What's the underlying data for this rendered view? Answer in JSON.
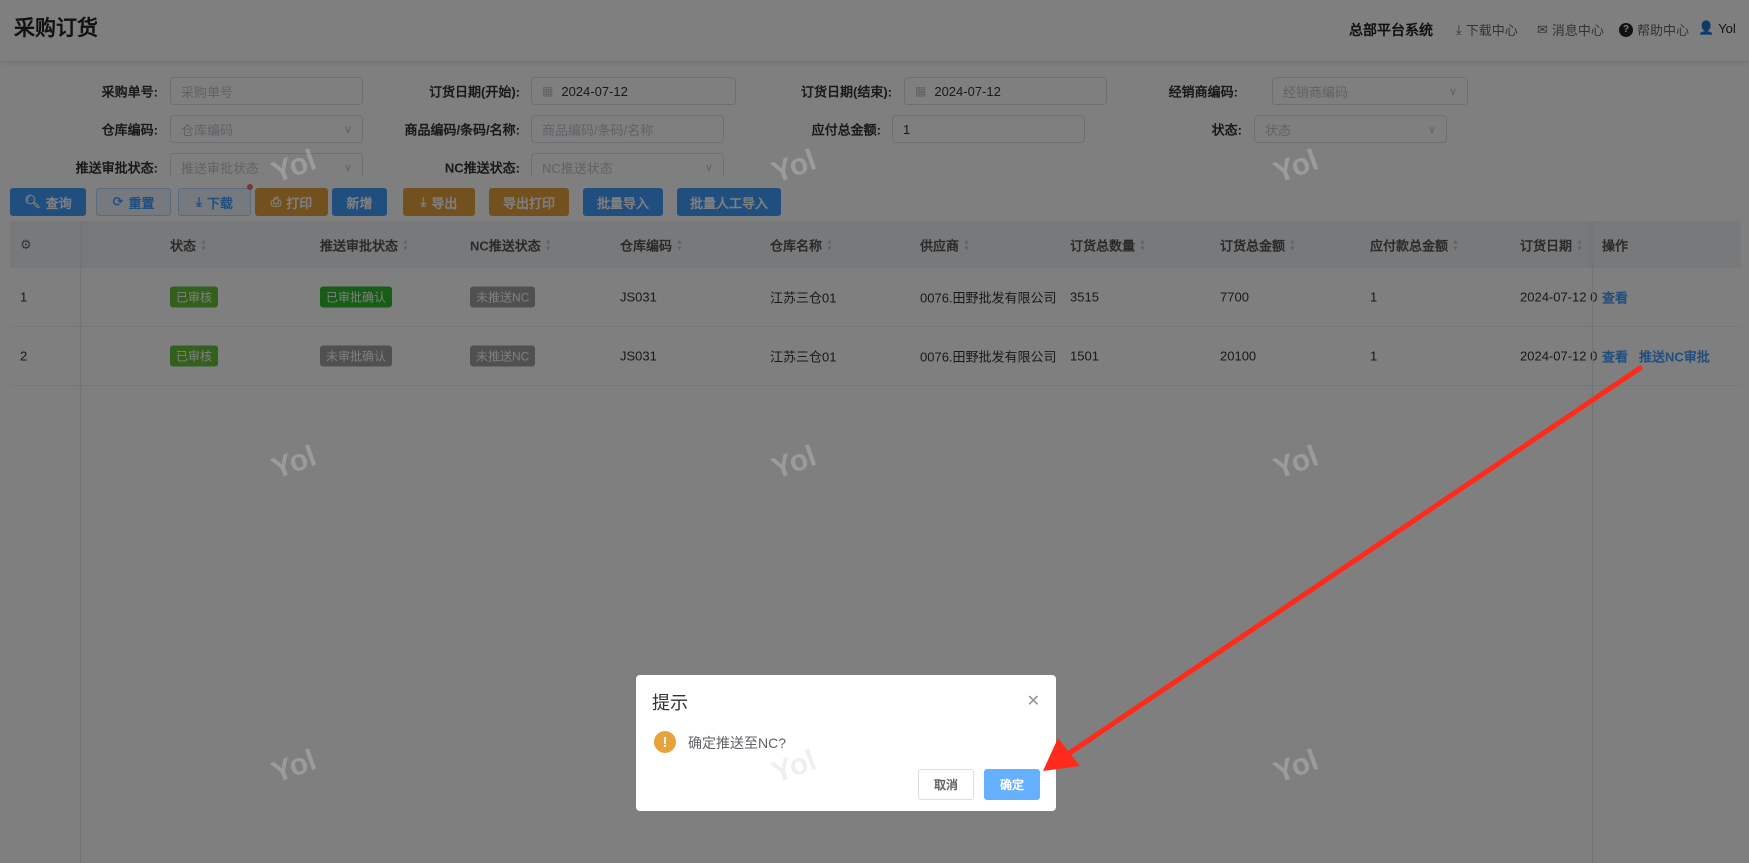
{
  "header": {
    "title": "采购订货",
    "system": "总部平台系统",
    "download_center": "下载中心",
    "message_center": "消息中心",
    "help_center": "帮助中心",
    "user": "Yol"
  },
  "filters": {
    "order_no": {
      "label": "采购单号:",
      "placeholder": "采购单号"
    },
    "date_start": {
      "label": "订货日期(开始):",
      "value": "2024-07-12"
    },
    "date_end": {
      "label": "订货日期(结束):",
      "value": "2024-07-12"
    },
    "dealer_code": {
      "label": "经销商编码:",
      "placeholder": "经销商编码"
    },
    "warehouse_code": {
      "label": "仓库编码:",
      "placeholder": "仓库编码"
    },
    "product": {
      "label": "商品编码/条码/名称:",
      "placeholder": "商品编码/条码/名称"
    },
    "payable_total": {
      "label": "应付总金额:",
      "value": "1"
    },
    "status": {
      "label": "状态:",
      "placeholder": "状态"
    },
    "push_approval_status": {
      "label": "推送审批状态:",
      "placeholder": "推送审批状态"
    },
    "nc_push_status": {
      "label": "NC推送状态:",
      "placeholder": "NC推送状态"
    }
  },
  "toolbar": {
    "query": "查询",
    "reset": "重置",
    "download": "下载",
    "print": "打印",
    "add": "新增",
    "export": "导出",
    "export_print": "导出打印",
    "batch_import": "批量导入",
    "batch_manual_import": "批量人工导入"
  },
  "table": {
    "columns": [
      "状态",
      "推送审批状态",
      "NC推送状态",
      "仓库编码",
      "仓库名称",
      "供应商",
      "订货总数量",
      "订货总金额",
      "应付款总金额",
      "订货日期",
      "操作"
    ],
    "rows": [
      {
        "index": "1",
        "status": "已审核",
        "push_approval": "已审批确认",
        "nc_push": "未推送NC",
        "warehouse_code": "JS031",
        "warehouse_name": "江苏三仓01",
        "supplier": "0076.田野批发有限公司",
        "qty": "3515",
        "amount": "7700",
        "payable": "1",
        "date": "2024-07-12 0",
        "actions": [
          "查看"
        ]
      },
      {
        "index": "2",
        "status": "已审核",
        "push_approval": "未审批确认",
        "nc_push": "未推送NC",
        "warehouse_code": "JS031",
        "warehouse_name": "江苏三仓01",
        "supplier": "0076.田野批发有限公司",
        "qty": "1501",
        "amount": "20100",
        "payable": "1",
        "date": "2024-07-12 0",
        "actions": [
          "查看",
          "推送NC审批"
        ]
      }
    ]
  },
  "dialog": {
    "title": "提示",
    "message": "确定推送至NC?",
    "cancel": "取消",
    "confirm": "确定"
  },
  "watermark": "Yol",
  "colors": {
    "primary": "#409eff",
    "warning": "#e6a23c",
    "success": "#67c23a",
    "arrow": "#ff2a1a"
  }
}
